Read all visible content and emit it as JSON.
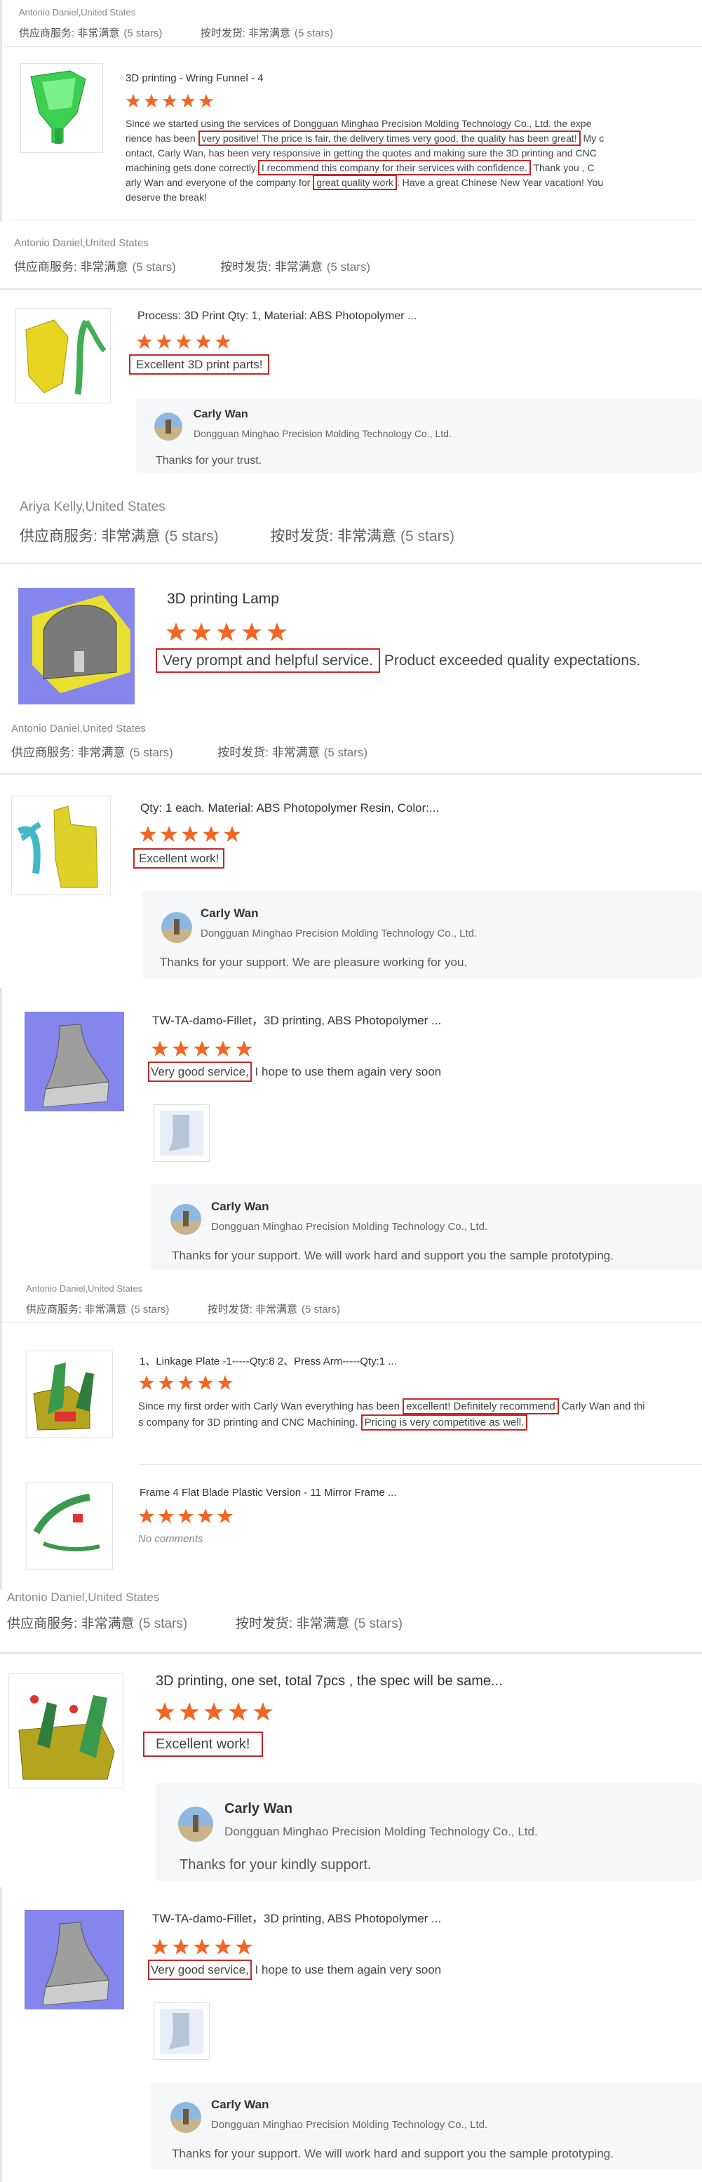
{
  "star_color": "#f26522",
  "highlight_color": "#c62828",
  "ratings_labels": {
    "supplier": "供应商服务: 非常满意",
    "delivery": "按时发货: 非常满意",
    "stars_text": "(5 stars)"
  },
  "reviews": [
    {
      "author": "Antonio Daniel,United States",
      "product_title": "3D printing - Wring Funnel - 4",
      "comment_line1_a": "Since we started using the services of Dongguan Minghao Precision Molding Technology Co., Ltd. the expe",
      "comment_line2_a": "rience has been ",
      "comment_line2_hl": "very positive! The price is fair, the delivery times very good, the quality has been great!",
      "comment_line2_b": " My c",
      "comment_line3_a": "ontact, Carly Wan, has been very responsive in getting the quotes and making sure the 3D printing and CNC",
      "comment_line4_a": "machining gets done correctly.",
      "comment_line4_hl": "I recommend this company for their services with confidence.",
      "comment_line4_b": " Thank you , C",
      "comment_line5_a": "arly Wan and everyone of the company for ",
      "comment_line5_hl": "great quality work",
      "comment_line5_b": ". Have a great Chinese New Year vacation! You",
      "comment_line6_a": "deserve the break!"
    },
    {
      "author": "Antonio Daniel,United States",
      "product_title": "Process: 3D Print Qty: 1, Material: ABS Photopolymer ...",
      "comment_hl": "Excellent 3D print parts!",
      "reply_name": "Carly Wan",
      "reply_company": "Dongguan Minghao Precision Molding Technology Co., Ltd.",
      "reply_text": "Thanks for your trust."
    },
    {
      "author": "Ariya Kelly,United States",
      "product_title": "3D printing Lamp",
      "comment_hl": "Very prompt and helpful service.",
      "comment_rest": " Product exceeded quality expectations."
    },
    {
      "author": "Antonio Daniel,United States",
      "product_title": "Qty: 1 each. Material: ABS Photopolymer Resin, Color:...",
      "comment_hl": "Excellent work!",
      "reply_name": "Carly Wan",
      "reply_company": "Dongguan Minghao Precision Molding Technology Co., Ltd.",
      "reply_text": "Thanks for your support. We are pleasure working for you."
    },
    {
      "product_title": "TW-TA-damo-Fillet，3D printing, ABS Photopolymer ...",
      "comment_hl": "Very good service,",
      "comment_rest": " I hope to use them again very soon",
      "reply_name": "Carly Wan",
      "reply_company": "Dongguan Minghao Precision Molding Technology Co., Ltd.",
      "reply_text": "Thanks for your support. We will work hard and support you the sample prototyping."
    },
    {
      "author": "Antonio Daniel,United States",
      "product_title": "1、Linkage Plate -1-----Qty:8 2、Press Arm-----Qty:1 ...",
      "comment_line1_a": "Since my first order with Carly Wan everything has been ",
      "comment_line1_hl": "excellent! Definitely recommend",
      "comment_line1_b": " Carly Wan and thi",
      "comment_line2_a": "s company for 3D printing and CNC Machining. ",
      "comment_line2_hl": "Pricing is very competitive as well.",
      "product2_title": "Frame 4 Flat Blade Plastic Version - 11 Mirror Frame ...",
      "product2_comment": "No comments"
    },
    {
      "author": "Antonio Daniel,United States",
      "product_title": "3D printing, one set, total 7pcs , the spec will be same...",
      "comment_hl": "Excellent work!",
      "reply_name": "Carly Wan",
      "reply_company": "Dongguan Minghao Precision Molding Technology Co., Ltd.",
      "reply_text": "Thanks for your kindly support."
    },
    {
      "product_title": "TW-TA-damo-Fillet，3D printing, ABS Photopolymer ...",
      "comment_hl": "Very good service,",
      "comment_rest": " I hope to use them again very soon",
      "reply_name": "Carly Wan",
      "reply_company": "Dongguan Minghao Precision Molding Technology Co., Ltd.",
      "reply_text": "Thanks for your support. We will work hard and support you the sample prototyping."
    }
  ]
}
